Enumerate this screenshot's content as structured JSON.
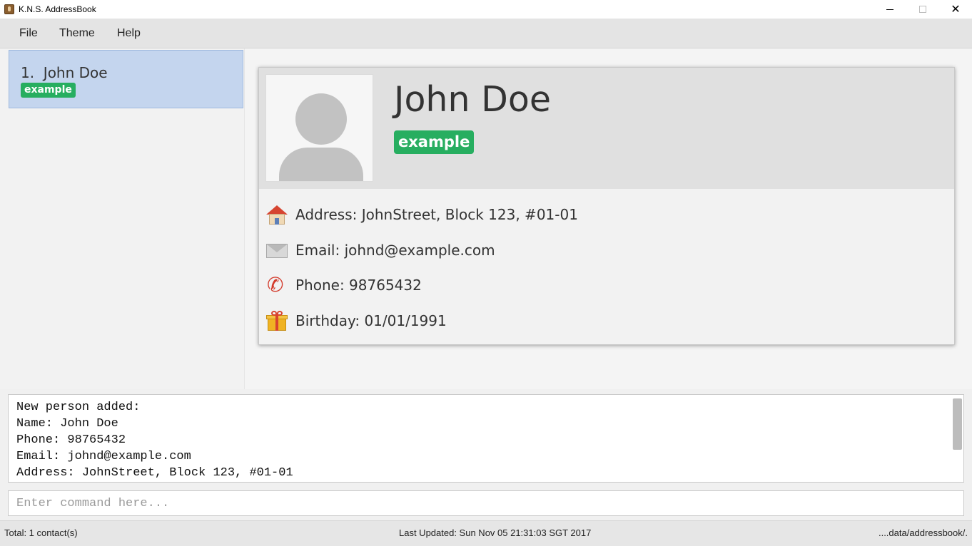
{
  "window": {
    "title": "K.N.S. AddressBook"
  },
  "menu": {
    "file": "File",
    "theme": "Theme",
    "help": "Help"
  },
  "person_list": [
    {
      "index_name": "1.  John Doe",
      "tag": "example"
    }
  ],
  "detail": {
    "name": "John Doe",
    "tag": "example",
    "address": "Address: JohnStreet, Block 123, #01-01",
    "email": "Email: johnd@example.com",
    "phone": "Phone: 98765432",
    "birthday": "Birthday: 01/01/1991",
    "icons": [
      "house-icon",
      "envelope-icon",
      "phone-icon",
      "gift-icon"
    ]
  },
  "result": {
    "text": "New person added:\nName: John Doe\nPhone: 98765432\nEmail: johnd@example.com\nAddress: JohnStreet, Block 123, #01-01"
  },
  "command": {
    "placeholder": "Enter command here...",
    "value": ""
  },
  "status": {
    "total": "Total: 1 contact(s)",
    "last_updated": "Last Updated: Sun Nov 05 21:31:03 SGT 2017",
    "path": "....data/addressbook/."
  },
  "colors": {
    "tag": "#27ae60",
    "selected_cell": "#c4d5ee"
  }
}
